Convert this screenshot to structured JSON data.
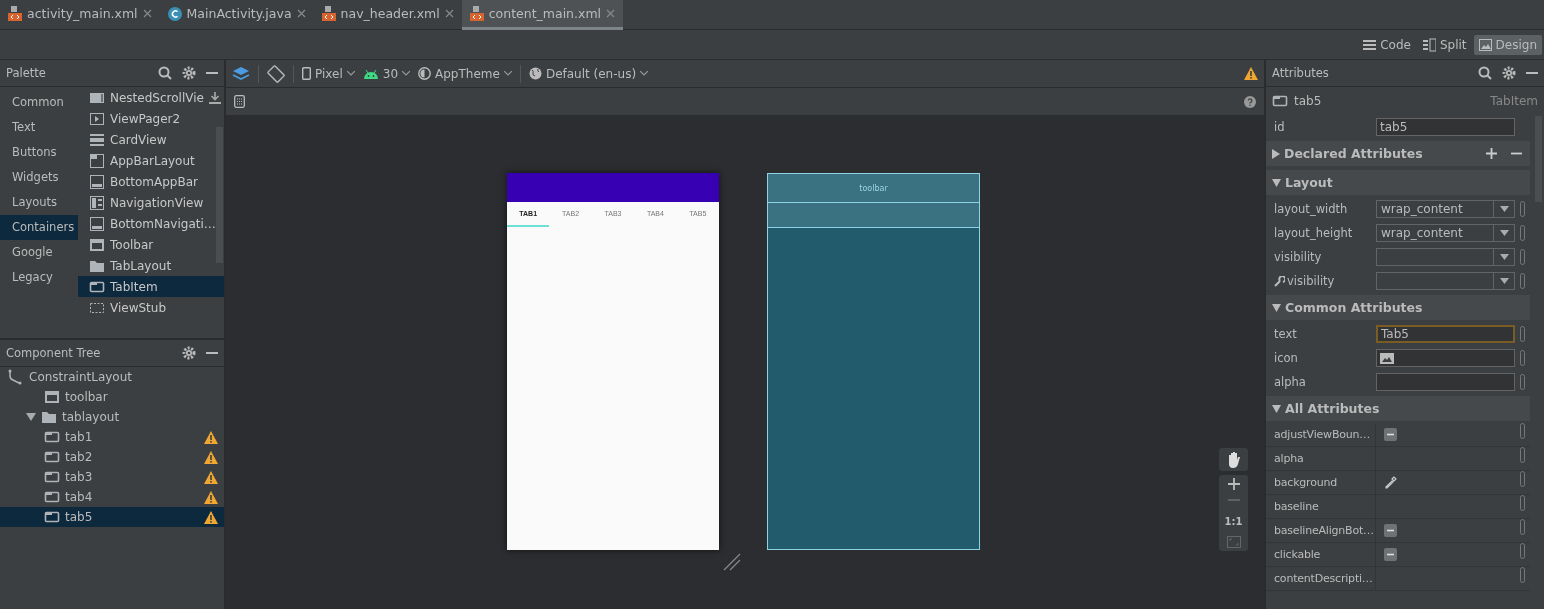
{
  "editor_tabs": [
    {
      "label": "activity_main.xml",
      "kind": "xml",
      "selected": false
    },
    {
      "label": "MainActivity.java",
      "kind": "class",
      "selected": false
    },
    {
      "label": "nav_header.xml",
      "kind": "xml",
      "selected": false
    },
    {
      "label": "content_main.xml",
      "kind": "xml",
      "selected": true
    }
  ],
  "view_modes": [
    {
      "label": "Code",
      "kind": "code",
      "selected": false
    },
    {
      "label": "Split",
      "kind": "split",
      "selected": false
    },
    {
      "label": "Design",
      "kind": "design",
      "selected": true
    }
  ],
  "palette": {
    "title": "Palette",
    "categories": [
      {
        "label": "Common",
        "selected": false
      },
      {
        "label": "Text",
        "selected": false
      },
      {
        "label": "Buttons",
        "selected": false
      },
      {
        "label": "Widgets",
        "selected": false
      },
      {
        "label": "Layouts",
        "selected": false
      },
      {
        "label": "Containers",
        "selected": true
      },
      {
        "label": "Google",
        "selected": false
      },
      {
        "label": "Legacy",
        "selected": false
      }
    ],
    "items": [
      {
        "label": "NestedScrollVie",
        "kind": "panel",
        "download": true,
        "selected": false
      },
      {
        "label": "ViewPager2",
        "kind": "pager",
        "download": false,
        "selected": false
      },
      {
        "label": "CardView",
        "kind": "card",
        "download": false,
        "selected": false
      },
      {
        "label": "AppBarLayout",
        "kind": "appbar",
        "download": false,
        "selected": false
      },
      {
        "label": "BottomAppBar",
        "kind": "bottombar",
        "download": false,
        "selected": false
      },
      {
        "label": "NavigationView",
        "kind": "nav",
        "download": false,
        "selected": false
      },
      {
        "label": "BottomNavigati…",
        "kind": "bottombar",
        "download": false,
        "selected": false
      },
      {
        "label": "Toolbar",
        "kind": "toolbar",
        "download": false,
        "selected": false
      },
      {
        "label": "TabLayout",
        "kind": "folder",
        "download": false,
        "selected": false
      },
      {
        "label": "TabItem",
        "kind": "tab",
        "download": false,
        "selected": true
      },
      {
        "label": "ViewStub",
        "kind": "stub",
        "download": false,
        "selected": false
      }
    ]
  },
  "component_tree": {
    "title": "Component Tree",
    "nodes": [
      {
        "label": "ConstraintLayout",
        "kind": "constraint",
        "warning": false,
        "selected": false,
        "children": [
          {
            "label": "toolbar",
            "kind": "toolbar",
            "warning": false,
            "selected": false
          },
          {
            "label": "tablayout",
            "kind": "folder",
            "warning": false,
            "selected": false,
            "expanded": true,
            "children": [
              {
                "label": "tab1",
                "kind": "tab",
                "warning": true,
                "selected": false
              },
              {
                "label": "tab2",
                "kind": "tab",
                "warning": true,
                "selected": false
              },
              {
                "label": "tab3",
                "kind": "tab",
                "warning": true,
                "selected": false
              },
              {
                "label": "tab4",
                "kind": "tab",
                "warning": true,
                "selected": false
              },
              {
                "label": "tab5",
                "kind": "tab",
                "warning": true,
                "selected": true
              }
            ]
          }
        ]
      }
    ]
  },
  "design_toolbar": {
    "device": "Pixel",
    "api": "30",
    "theme": "AppTheme",
    "locale": "Default (en-us)",
    "warning": true
  },
  "preview": {
    "tabs": [
      {
        "label": "TAB1",
        "selected": true
      },
      {
        "label": "TAB2",
        "selected": false
      },
      {
        "label": "TAB3",
        "selected": false
      },
      {
        "label": "TAB4",
        "selected": false
      },
      {
        "label": "TAB5",
        "selected": false
      }
    ]
  },
  "blueprint": {
    "toolbar_label": "toolbar"
  },
  "zoom_controls": {
    "reset": "1:1"
  },
  "attributes": {
    "title": "Attributes",
    "component": "tab5",
    "component_type": "TabItem",
    "id": {
      "name": "id",
      "value": "tab5"
    },
    "sections": [
      {
        "title": "Declared Attributes",
        "expanded": false,
        "has_actions": true
      },
      {
        "title": "Layout",
        "expanded": true,
        "has_actions": false,
        "rows": [
          {
            "name": "layout_width",
            "kind": "dropdown",
            "value": "wrap_content",
            "tool": false
          },
          {
            "name": "layout_height",
            "kind": "dropdown",
            "value": "wrap_content",
            "tool": false
          },
          {
            "name": "visibility",
            "kind": "dropdown",
            "tool": false
          },
          {
            "name": "visibility",
            "kind": "dropdown",
            "tool": true
          }
        ]
      },
      {
        "title": "Common Attributes",
        "expanded": true,
        "has_actions": false,
        "rows": [
          {
            "name": "text",
            "kind": "text",
            "value": "Tab5",
            "focused": true
          },
          {
            "name": "icon",
            "kind": "image",
            "focused": false
          },
          {
            "name": "alpha",
            "kind": "text",
            "focused": false
          }
        ]
      },
      {
        "title": "All Attributes",
        "expanded": true,
        "has_actions": false,
        "grid": true,
        "rows": [
          {
            "name": "adjustViewBoun…",
            "kind": "flag"
          },
          {
            "name": "alpha",
            "kind": "none"
          },
          {
            "name": "background",
            "kind": "color"
          },
          {
            "name": "baseline",
            "kind": "none"
          },
          {
            "name": "baselineAlignBot…",
            "kind": "flag"
          },
          {
            "name": "clickable",
            "kind": "flag"
          },
          {
            "name": "contentDescripti…",
            "kind": "none"
          }
        ]
      }
    ]
  }
}
